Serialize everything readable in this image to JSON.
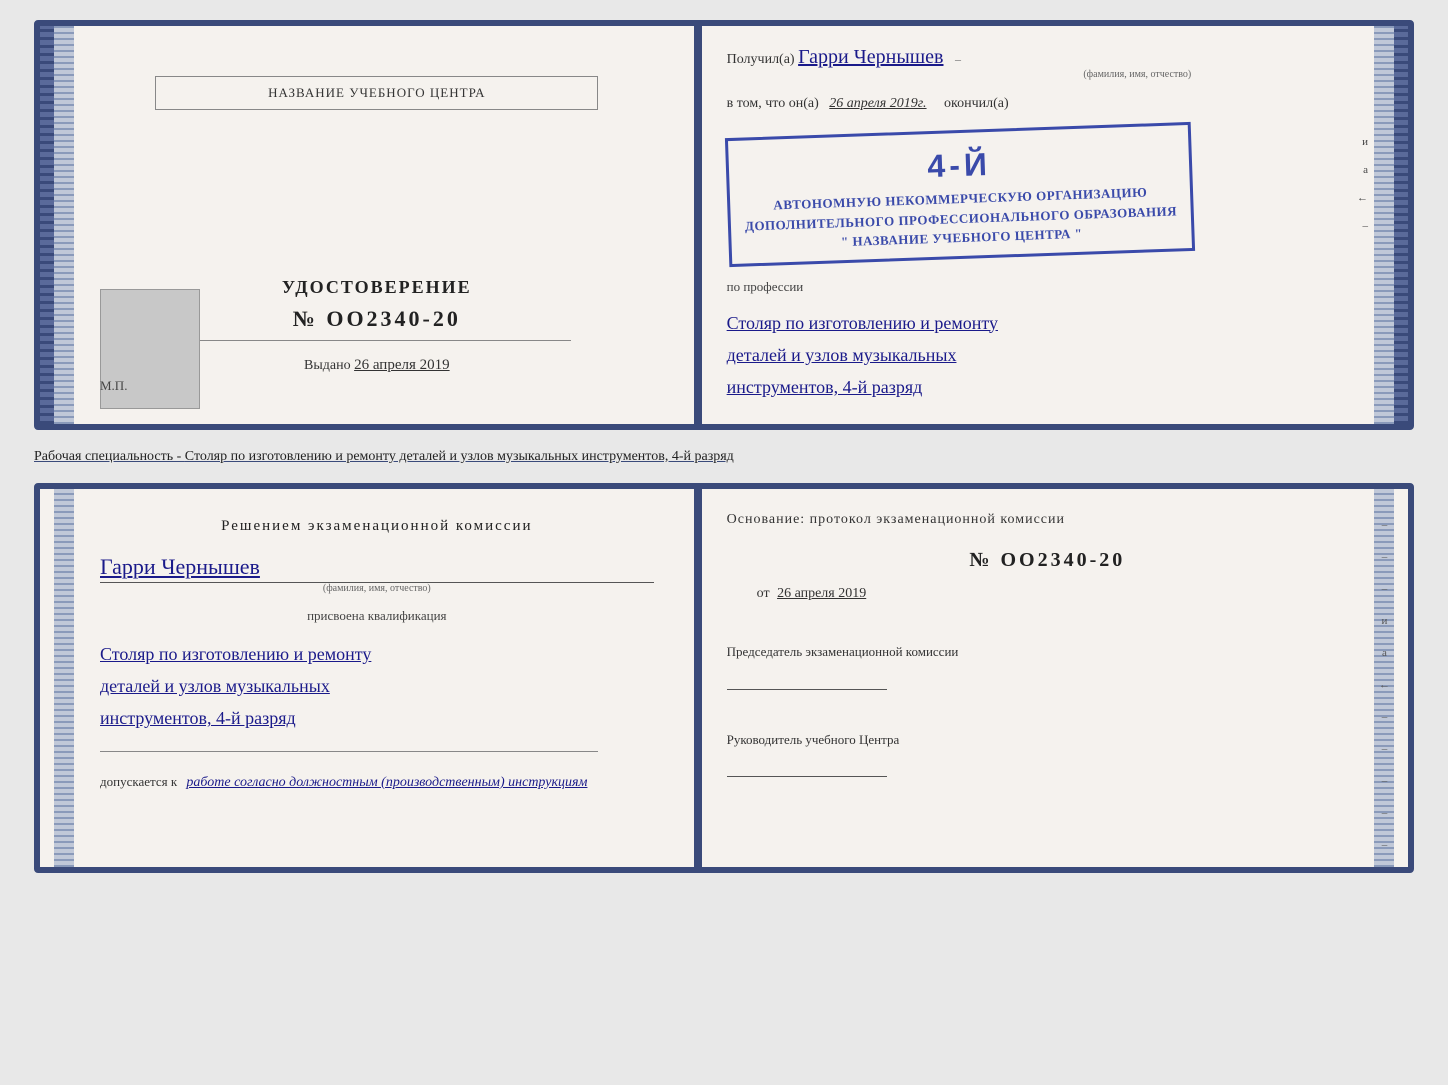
{
  "top_doc": {
    "left": {
      "org_label": "НАЗВАНИЕ УЧЕБНОГО ЦЕНТРА",
      "cert_title": "УДОСТОВЕРЕНИЕ",
      "cert_number": "№ OO2340-20",
      "issued_label": "Выдано",
      "issued_date": "26 апреля 2019",
      "mp_label": "М.П."
    },
    "right": {
      "received_label": "Получил(а)",
      "recipient_name": "Гарри Чернышев",
      "name_subtitle": "(фамилия, имя, отчество)",
      "in_that_label": "в том, что он(а)",
      "date_value": "26 апреля 2019г.",
      "finished_label": "окончил(а)",
      "stamp_line1": "АВТОНОМНУЮ НЕКОММЕРЧЕСКУЮ ОРГАНИЗАЦИЮ",
      "stamp_line2": "ДОПОЛНИТЕЛЬНОГО ПРОФЕССИОНАЛЬНОГО ОБРАЗОВАНИЯ",
      "stamp_line3": "\" НАЗВАНИЕ УЧЕБНОГО ЦЕНТРА \"",
      "stamp_number": "4-й",
      "by_profession_label": "по профессии",
      "profession_line1": "Столяр по изготовлению и ремонту",
      "profession_line2": "деталей и узлов музыкальных",
      "profession_line3": "инструментов, 4-й разряд"
    }
  },
  "caption": {
    "text_plain": "Рабочая специальность - ",
    "text_underline": "Столяр по изготовлению и ремонту деталей и узлов музыкальных инструментов, 4-й разряд"
  },
  "bottom_doc": {
    "left": {
      "decision_title": "Решением  экзаменационной  комиссии",
      "person_name": "Гарри Чернышев",
      "name_subtitle": "(фамилия, имя, отчество)",
      "assigned_label": "присвоена квалификация",
      "qualification_line1": "Столяр по изготовлению и ремонту",
      "qualification_line2": "деталей и узлов музыкальных",
      "qualification_line3": "инструментов, 4-й разряд",
      "allowed_label": "допускается к",
      "allowed_value": "работе согласно должностным (производственным) инструкциям"
    },
    "right": {
      "basis_label": "Основание: протокол экзаменационной  комиссии",
      "protocol_number": "№  OO2340-20",
      "from_label": "от",
      "from_date": "26 апреля 2019",
      "chairman_label": "Председатель экзаменационной комиссии",
      "director_label": "Руководитель учебного Центра"
    },
    "right_vert": [
      "и",
      "а",
      "←",
      "–",
      "–",
      "–",
      "–",
      "–"
    ]
  }
}
